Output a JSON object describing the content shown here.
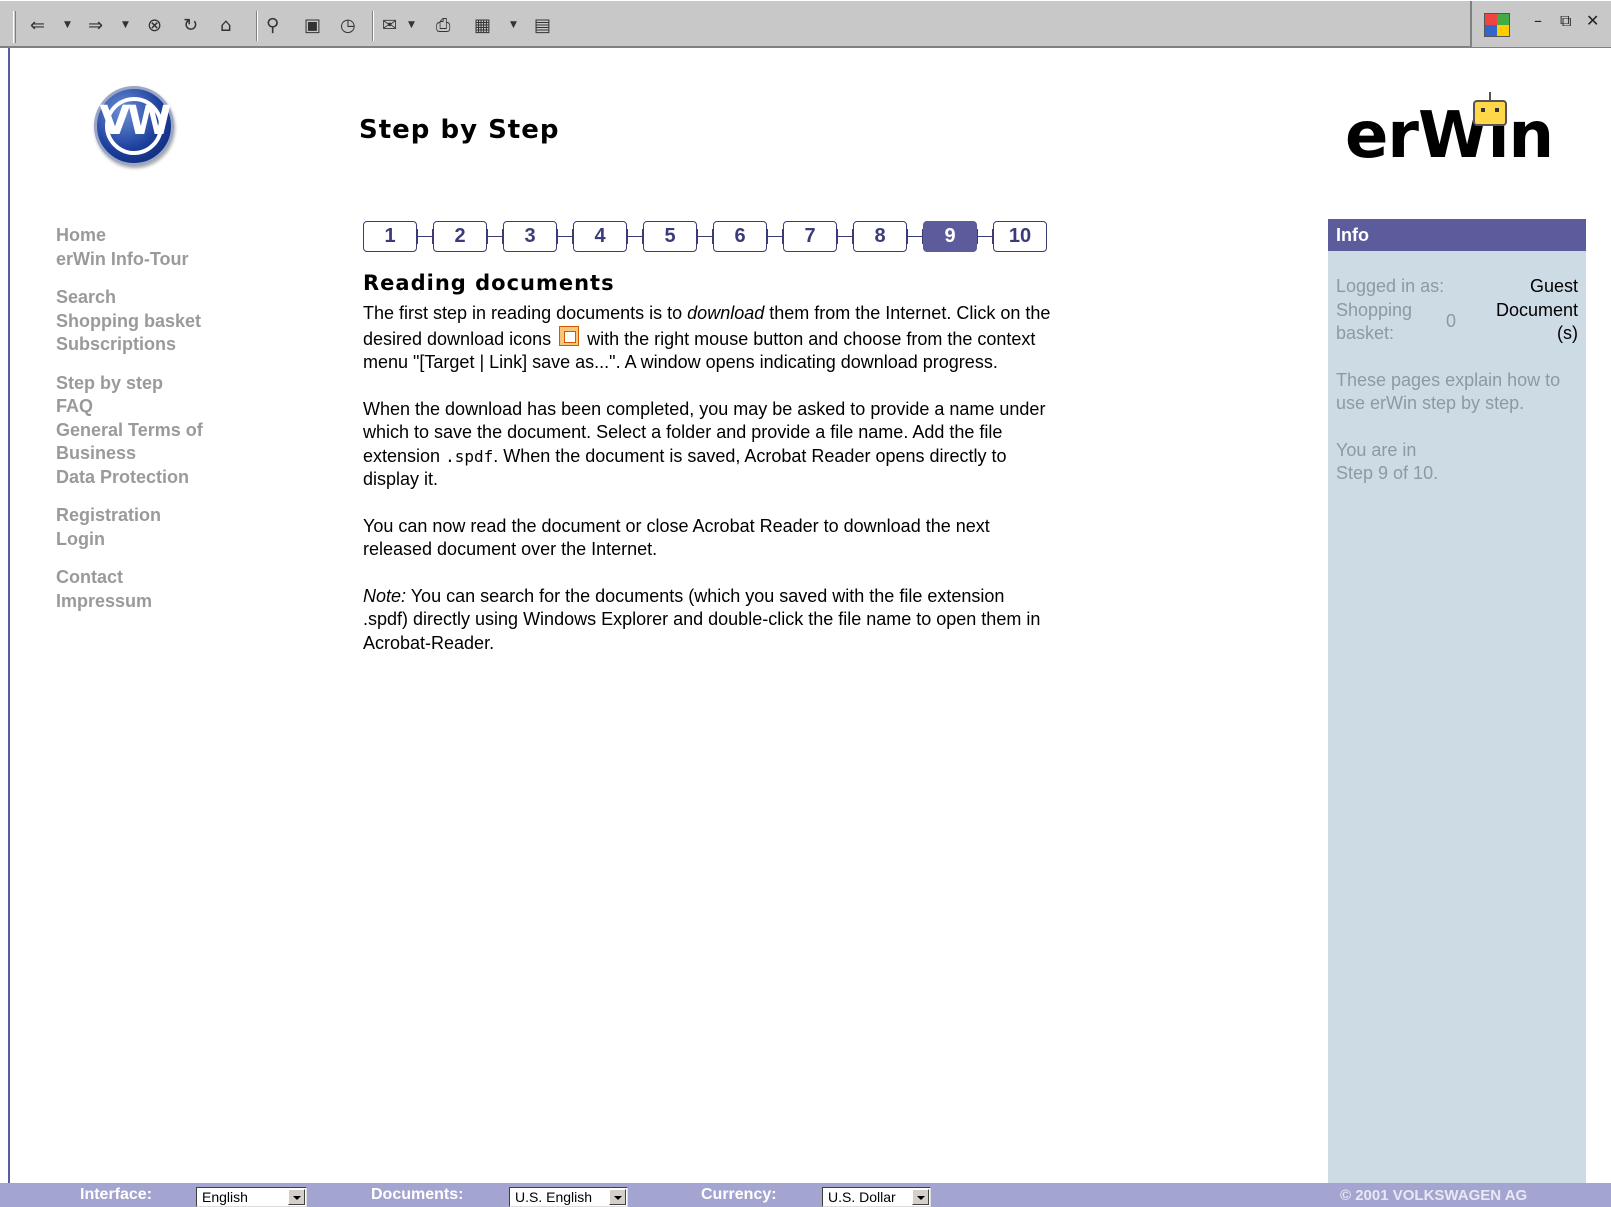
{
  "toolbar": {
    "buttons": [
      "back-icon",
      "forward-icon",
      "stop-icon",
      "refresh-icon",
      "home-icon",
      "search-icon",
      "favorites-icon",
      "history-icon",
      "mail-icon",
      "print-icon",
      "edit-icon",
      "discuss-icon"
    ],
    "window_controls": [
      "minimize-icon",
      "restore-icon",
      "close-icon"
    ]
  },
  "header": {
    "title": "Step by Step",
    "brand_left": "VW",
    "brand_right": "erWin"
  },
  "nav": {
    "groups": [
      [
        "Home",
        "erWin Info-Tour"
      ],
      [
        "Search",
        "Shopping basket",
        "Subscriptions"
      ],
      [
        "Step by step",
        "FAQ",
        "General Terms of Business",
        "Data Protection"
      ],
      [
        "Registration",
        "Login"
      ],
      [
        "Contact",
        "Impressum"
      ]
    ]
  },
  "steps": {
    "labels": [
      "1",
      "2",
      "3",
      "4",
      "5",
      "6",
      "7",
      "8",
      "9",
      "10"
    ],
    "active": "9"
  },
  "content": {
    "heading": "Reading documents",
    "p1a": "The first step in reading documents is to ",
    "p1em": "download",
    "p1b": " them from the Internet. Click on the desired download icons ",
    "p1c": " with the right mouse button and choose from the context menu \"[Target | Link] save as...\". A window opens indicating download progress.",
    "p2a": "When the download has been completed, you may be asked to provide a name under which to save the document. Select a folder and provide a file name. Add the file extension ",
    "p2code": ".spdf",
    "p2b": ". When the document is saved, Acrobat Reader opens directly to display it.",
    "p3": "You can now read the document or close Acrobat Reader to download the next released document over the Internet.",
    "p4em": "Note:",
    "p4": " You can search for the documents (which you saved with the file extension .spdf) directly using Windows Explorer and double-click the file name to open them in Acrobat-Reader."
  },
  "info": {
    "title": "Info",
    "logged_in_label": "Logged in as:",
    "logged_in_value": "Guest",
    "basket_label": "Shopping basket:",
    "basket_count": "0",
    "basket_unit": "Document (s)",
    "explain": "These pages explain how to use erWin step by step.",
    "position_line1": "You are in",
    "position_line2": "Step 9 of 10."
  },
  "footer": {
    "interface_label": "Interface:",
    "interface_value": "English",
    "documents_label": "Documents:",
    "documents_value": "U.S. English",
    "currency_label": "Currency:",
    "currency_value": "U.S. Dollar",
    "copyright": "© 2001 VOLKSWAGEN AG"
  },
  "colors": {
    "accent": "#5c5c9c",
    "info_bg": "#cddbe5",
    "nav_text": "#9a9a9a",
    "footer_bg": "#a4a4d0"
  }
}
